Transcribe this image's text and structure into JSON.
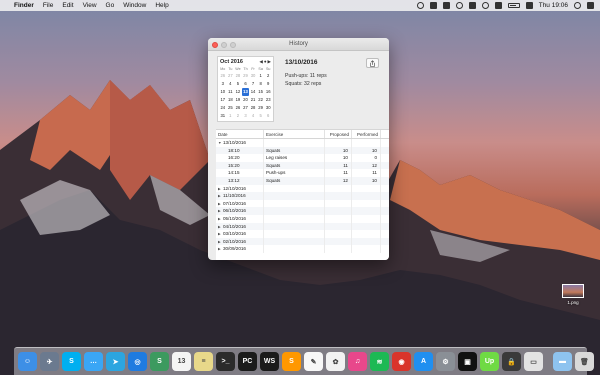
{
  "menubar": {
    "app": "Finder",
    "items": [
      "File",
      "Edit",
      "View",
      "Go",
      "Window",
      "Help"
    ],
    "clock": "Thu 19:06"
  },
  "window": {
    "title": "History"
  },
  "calendar": {
    "month_label": "Oct 2016",
    "days_of_week": [
      "Mo",
      "Tu",
      "We",
      "Th",
      "Fr",
      "Sa",
      "Su"
    ],
    "weeks": [
      [
        "26",
        "27",
        "28",
        "29",
        "30",
        "1",
        "2"
      ],
      [
        "3",
        "4",
        "5",
        "6",
        "7",
        "8",
        "9"
      ],
      [
        "10",
        "11",
        "12",
        "13",
        "14",
        "15",
        "16"
      ],
      [
        "17",
        "18",
        "19",
        "20",
        "21",
        "22",
        "23"
      ],
      [
        "24",
        "25",
        "26",
        "27",
        "28",
        "29",
        "30"
      ],
      [
        "31",
        "1",
        "2",
        "3",
        "4",
        "5",
        "6"
      ]
    ],
    "selected": "13"
  },
  "detail": {
    "date": "13/10/2016",
    "lines": [
      "Push-ups: 11 reps",
      "Squats: 32 reps"
    ]
  },
  "table": {
    "headers": [
      "Date",
      "Exercise",
      "Proposed",
      "Performed"
    ],
    "rows": [
      {
        "date": "13/10/2016",
        "expanded": true,
        "exercise": "",
        "proposed": "",
        "performed": ""
      },
      {
        "date": "18:10",
        "child": true,
        "exercise": "Squats",
        "proposed": "10",
        "performed": "10"
      },
      {
        "date": "16:20",
        "child": true,
        "exercise": "Leg raises",
        "proposed": "10",
        "performed": "0"
      },
      {
        "date": "15:20",
        "child": true,
        "exercise": "Squats",
        "proposed": "11",
        "performed": "12"
      },
      {
        "date": "14:15",
        "child": true,
        "exercise": "Push-ups",
        "proposed": "11",
        "performed": "11"
      },
      {
        "date": "13:12",
        "child": true,
        "exercise": "Squats",
        "proposed": "12",
        "performed": "10"
      },
      {
        "date": "12/10/2016",
        "expanded": false,
        "exercise": "",
        "proposed": "",
        "performed": ""
      },
      {
        "date": "11/10/2016",
        "expanded": false,
        "exercise": "",
        "proposed": "",
        "performed": ""
      },
      {
        "date": "07/10/2016",
        "expanded": false,
        "exercise": "",
        "proposed": "",
        "performed": ""
      },
      {
        "date": "06/10/2016",
        "expanded": false,
        "exercise": "",
        "proposed": "",
        "performed": ""
      },
      {
        "date": "05/10/2016",
        "expanded": false,
        "exercise": "",
        "proposed": "",
        "performed": ""
      },
      {
        "date": "04/10/2016",
        "expanded": false,
        "exercise": "",
        "proposed": "",
        "performed": ""
      },
      {
        "date": "03/10/2016",
        "expanded": false,
        "exercise": "",
        "proposed": "",
        "performed": ""
      },
      {
        "date": "02/10/2016",
        "expanded": false,
        "exercise": "",
        "proposed": "",
        "performed": ""
      },
      {
        "date": "30/09/2016",
        "expanded": false,
        "exercise": "",
        "proposed": "",
        "performed": ""
      }
    ]
  },
  "desktop_file": {
    "label": "1.png"
  },
  "dock": {
    "apps": [
      {
        "name": "finder-icon",
        "color": "#3d8fe6",
        "glyph": "☺"
      },
      {
        "name": "launchpad-icon",
        "color": "#6b7a8f",
        "glyph": "✈"
      },
      {
        "name": "skype-icon",
        "color": "#00aff0",
        "glyph": "S"
      },
      {
        "name": "messages-icon",
        "color": "#3aa6f5",
        "glyph": "…"
      },
      {
        "name": "telegram-icon",
        "color": "#2ca5e0",
        "glyph": "➤"
      },
      {
        "name": "safari-icon",
        "color": "#1f7be0",
        "glyph": "◎"
      },
      {
        "name": "bbedit-icon",
        "color": "#3c9a5f",
        "glyph": "S"
      },
      {
        "name": "calendar-icon",
        "color": "#f5f5f5",
        "glyph": "13"
      },
      {
        "name": "notes-icon",
        "color": "#e8d88a",
        "glyph": "≡"
      },
      {
        "name": "terminal-icon",
        "color": "#2b2b2b",
        "glyph": ">_"
      },
      {
        "name": "pycharm-icon",
        "color": "#1b1b1b",
        "glyph": "PC"
      },
      {
        "name": "webstorm-icon",
        "color": "#1b1b1b",
        "glyph": "WS"
      },
      {
        "name": "sublime-icon",
        "color": "#ff9800",
        "glyph": "S"
      },
      {
        "name": "textedit-icon",
        "color": "#f7f7f7",
        "glyph": "✎"
      },
      {
        "name": "photos-icon",
        "color": "#f2f2f2",
        "glyph": "✿"
      },
      {
        "name": "itunes-icon",
        "color": "#e8478b",
        "glyph": "♫"
      },
      {
        "name": "spotify-icon",
        "color": "#1db954",
        "glyph": "≋"
      },
      {
        "name": "target-icon",
        "color": "#d9342b",
        "glyph": "◉"
      },
      {
        "name": "appstore-icon",
        "color": "#1f8ff0",
        "glyph": "A"
      },
      {
        "name": "preferences-icon",
        "color": "#8a8f96",
        "glyph": "⚙"
      },
      {
        "name": "activity-icon",
        "color": "#111111",
        "glyph": "▣"
      },
      {
        "name": "upwork-icon",
        "color": "#6fda44",
        "glyph": "Up"
      },
      {
        "name": "keychain-icon",
        "color": "#3a3a3a",
        "glyph": "🔒"
      },
      {
        "name": "quicktime-icon",
        "color": "#e3e3e3",
        "glyph": "▭"
      }
    ],
    "right": [
      {
        "name": "folder-icon",
        "color": "#8ec3ef",
        "glyph": "▬"
      },
      {
        "name": "trash-icon",
        "color": "#d9d9d9",
        "glyph": "🗑"
      }
    ]
  }
}
